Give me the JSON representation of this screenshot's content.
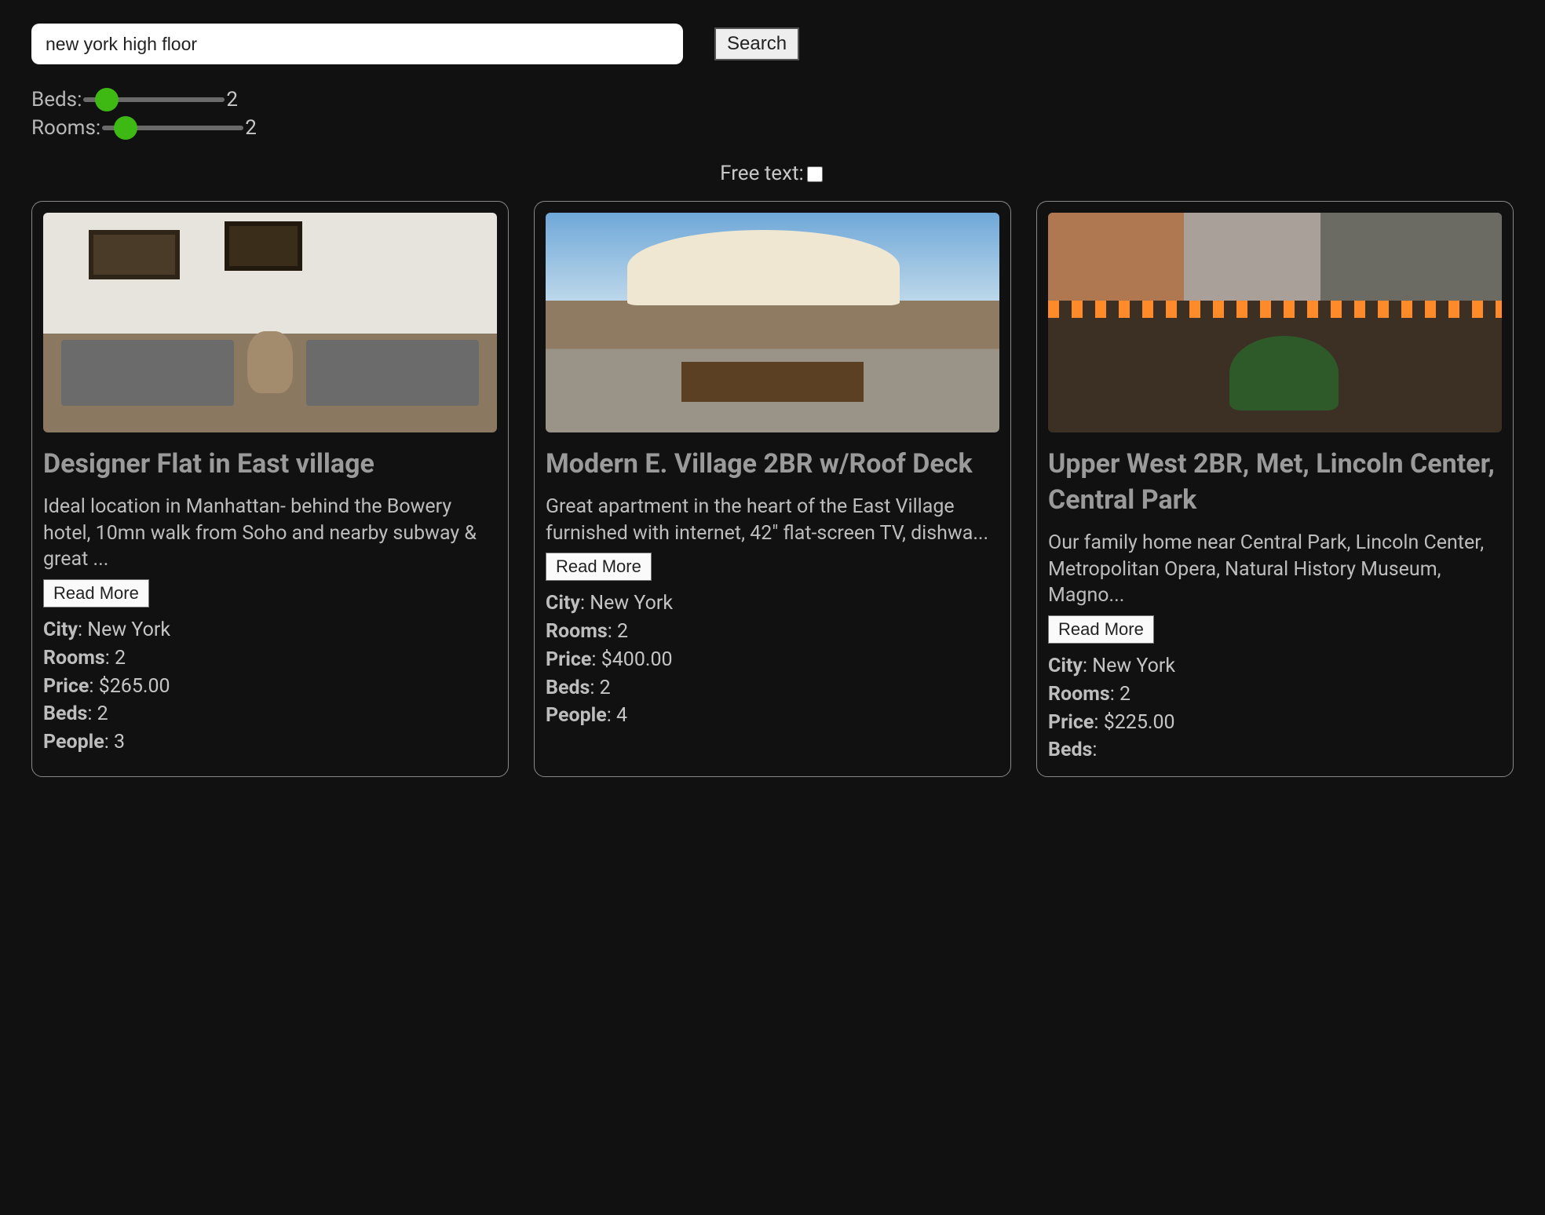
{
  "search": {
    "query": "new york high floor",
    "button": "Search"
  },
  "filters": {
    "beds_label": "Beds:",
    "beds_value": "2",
    "rooms_label": "Rooms:",
    "rooms_value": "2",
    "freetext_label": "Free text:"
  },
  "meta_labels": {
    "city": "City",
    "rooms": "Rooms",
    "price": "Price",
    "beds": "Beds",
    "people": "People"
  },
  "read_more": "Read More",
  "listings": [
    {
      "title": "Designer Flat in East village",
      "desc": "Ideal location in Manhattan- behind the Bowery hotel, 10mn walk from Soho and nearby subway & great ...",
      "city": "New York",
      "rooms": "2",
      "price": "$265.00",
      "beds": "2",
      "people": "3"
    },
    {
      "title": "Modern E. Village 2BR w/Roof Deck",
      "desc": "Great apartment in the heart of the East Village furnished with internet, 42\" flat-screen TV, dishwa...",
      "city": "New York",
      "rooms": "2",
      "price": "$400.00",
      "beds": "2",
      "people": "4"
    },
    {
      "title": "Upper West 2BR, Met, Lincoln Center, Central Park",
      "desc": "Our family home near Central Park, Lincoln Center, Metropolitan Opera, Natural History Museum, Magno...",
      "city": "New York",
      "rooms": "2",
      "price": "$225.00",
      "beds": "",
      "people": ""
    }
  ]
}
